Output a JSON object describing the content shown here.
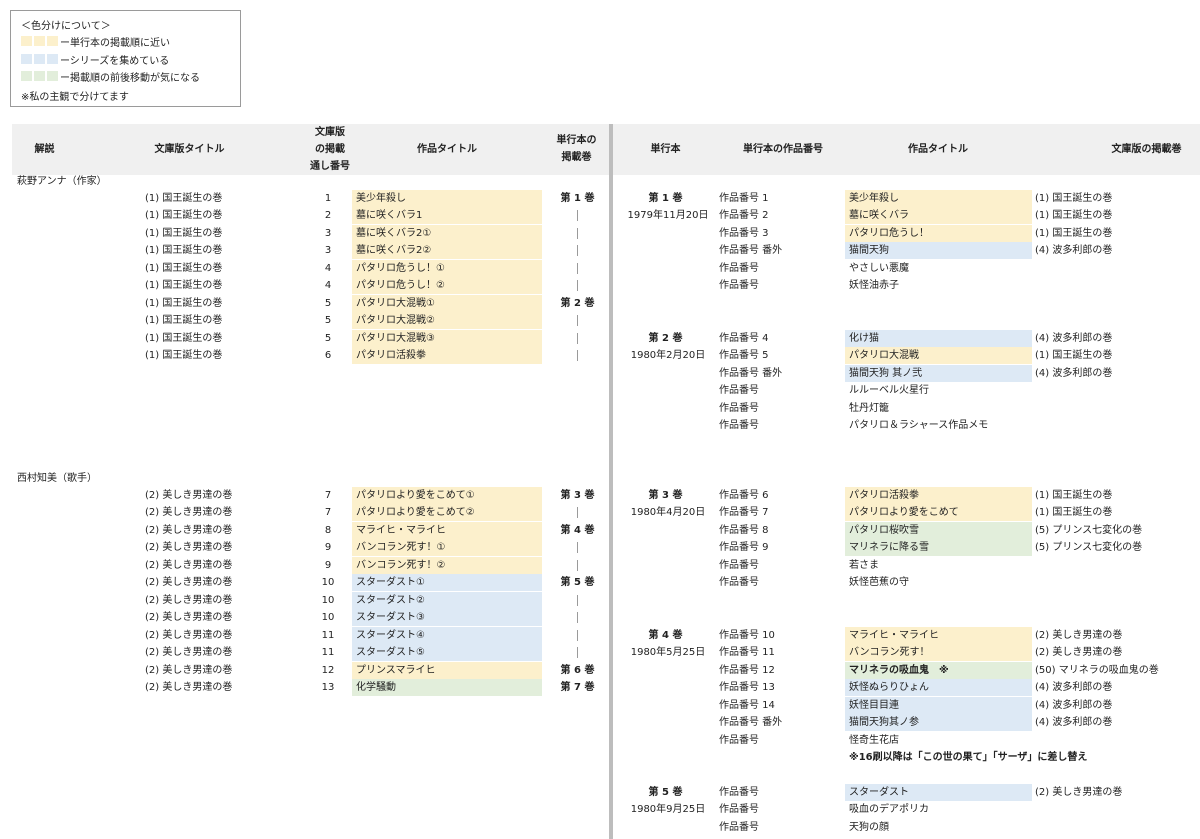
{
  "colors": {
    "yellow": "#fcf0cc",
    "blue": "#dde9f5",
    "green": "#e2eedb",
    "header": "#f0f0f0"
  },
  "legend": {
    "title": "＜色分けについて＞",
    "items": [
      {
        "color": "yellow",
        "label": "ー単行本の掲載順に近い"
      },
      {
        "color": "blue",
        "label": "ーシリーズを集めている"
      },
      {
        "color": "green",
        "label": "ー掲載順の前後移動が気になる"
      }
    ],
    "note": "※私の主観で分けてます"
  },
  "left_headers": {
    "commentary": "解説",
    "bunko_title": "文庫版タイトル",
    "number_l1": "文庫版",
    "number_l2": "の掲載",
    "number_l3": "通し番号",
    "work_title": "作品タイトル",
    "vol_l1": "単行本の",
    "vol_l2": "掲載巻"
  },
  "right_headers": {
    "volume": "単行本",
    "work_number": "単行本の作品番号",
    "work_title": "作品タイトル",
    "bunko_volume": "文庫版の掲載巻"
  },
  "left_sections": [
    {
      "commentary": "萩野アンナ（作家）",
      "rows": [
        {
          "bunko": "(1) 国王誕生の巻",
          "num": "1",
          "title": "美少年殺し",
          "color": "yellow",
          "vol": "第 1 巻"
        },
        {
          "bunko": "(1) 国王誕生の巻",
          "num": "2",
          "title": "墓に咲くバラ1",
          "color": "yellow",
          "vol": "|"
        },
        {
          "bunko": "(1) 国王誕生の巻",
          "num": "3",
          "title": "墓に咲くバラ2①",
          "color": "yellow",
          "vol": "|"
        },
        {
          "bunko": "(1) 国王誕生の巻",
          "num": "3",
          "title": "墓に咲くバラ2②",
          "color": "yellow",
          "vol": "|"
        },
        {
          "bunko": "(1) 国王誕生の巻",
          "num": "4",
          "title": "パタリロ危うし！①",
          "color": "yellow",
          "vol": "|"
        },
        {
          "bunko": "(1) 国王誕生の巻",
          "num": "4",
          "title": "パタリロ危うし！②",
          "color": "yellow",
          "vol": "|"
        },
        {
          "bunko": "(1) 国王誕生の巻",
          "num": "5",
          "title": "パタリロ大混戦①",
          "color": "yellow",
          "vol": "第 2 巻"
        },
        {
          "bunko": "(1) 国王誕生の巻",
          "num": "5",
          "title": "パタリロ大混戦②",
          "color": "yellow",
          "vol": "|"
        },
        {
          "bunko": "(1) 国王誕生の巻",
          "num": "5",
          "title": "パタリロ大混戦③",
          "color": "yellow",
          "vol": "|"
        },
        {
          "bunko": "(1) 国王誕生の巻",
          "num": "6",
          "title": "パタリロ活殺拳",
          "color": "yellow",
          "vol": "|"
        }
      ]
    },
    {
      "commentary": "西村知美（歌手）",
      "rows": [
        {
          "bunko": "(2) 美しき男達の巻",
          "num": "7",
          "title": "パタリロより愛をこめて①",
          "color": "yellow",
          "vol": "第 3 巻"
        },
        {
          "bunko": "(2) 美しき男達の巻",
          "num": "7",
          "title": "パタリロより愛をこめて②",
          "color": "yellow",
          "vol": "|"
        },
        {
          "bunko": "(2) 美しき男達の巻",
          "num": "8",
          "title": "マライヒ・マライヒ",
          "color": "yellow",
          "vol": "第 4 巻"
        },
        {
          "bunko": "(2) 美しき男達の巻",
          "num": "9",
          "title": "バンコラン死す！①",
          "color": "yellow",
          "vol": "|"
        },
        {
          "bunko": "(2) 美しき男達の巻",
          "num": "9",
          "title": "バンコラン死す！②",
          "color": "yellow",
          "vol": "|"
        },
        {
          "bunko": "(2) 美しき男達の巻",
          "num": "10",
          "title": "スターダスト①",
          "color": "blue",
          "vol": "第 5 巻"
        },
        {
          "bunko": "(2) 美しき男達の巻",
          "num": "10",
          "title": "スターダスト②",
          "color": "blue",
          "vol": "|"
        },
        {
          "bunko": "(2) 美しき男達の巻",
          "num": "10",
          "title": "スターダスト③",
          "color": "blue",
          "vol": "|"
        },
        {
          "bunko": "(2) 美しき男達の巻",
          "num": "11",
          "title": "スターダスト④",
          "color": "blue",
          "vol": "|"
        },
        {
          "bunko": "(2) 美しき男達の巻",
          "num": "11",
          "title": "スターダスト⑤",
          "color": "blue",
          "vol": "|"
        },
        {
          "bunko": "(2) 美しき男達の巻",
          "num": "12",
          "title": "プリンスマライヒ",
          "color": "yellow",
          "vol": "第 6 巻"
        },
        {
          "bunko": "(2) 美しき男達の巻",
          "num": "13",
          "title": "化学騒動",
          "color": "green",
          "vol": "第 7 巻"
        }
      ]
    }
  ],
  "right_groups": [
    {
      "volume": "第 1 巻",
      "date": "1979年11月20日",
      "rows": [
        {
          "work_no": "作品番号 1",
          "title": "美少年殺し",
          "color": "yellow",
          "bunko": "(1) 国王誕生の巻"
        },
        {
          "work_no": "作品番号 2",
          "title": "墓に咲くバラ",
          "color": "yellow",
          "bunko": "(1) 国王誕生の巻"
        },
        {
          "work_no": "作品番号 3",
          "title": "パタリロ危うし！",
          "color": "yellow",
          "bunko": "(1) 国王誕生の巻"
        },
        {
          "work_no": "作品番号 番外",
          "title": "猫間天狗",
          "color": "blue",
          "bunko": "(4) 波多利郎の巻"
        },
        {
          "work_no": "作品番号",
          "title": "やさしい悪魔",
          "color": "",
          "bunko": ""
        },
        {
          "work_no": "作品番号",
          "title": "妖怪油赤子",
          "color": "",
          "bunko": ""
        }
      ]
    },
    {
      "volume": "第 2 巻",
      "date": "1980年2月20日",
      "rows": [
        {
          "work_no": "作品番号 4",
          "title": "化け猫",
          "color": "blue",
          "bunko": "(4) 波多利郎の巻"
        },
        {
          "work_no": "作品番号 5",
          "title": "パタリロ大混戦",
          "color": "yellow",
          "bunko": "(1) 国王誕生の巻"
        },
        {
          "work_no": "作品番号 番外",
          "title": "猫間天狗 其ノ弐",
          "color": "blue",
          "bunko": "(4) 波多利郎の巻"
        },
        {
          "work_no": "作品番号",
          "title": "ルルーベル火星行",
          "color": "",
          "bunko": ""
        },
        {
          "work_no": "作品番号",
          "title": "牡丹灯籠",
          "color": "",
          "bunko": ""
        },
        {
          "work_no": "作品番号",
          "title": "パタリロ＆ラシャース作品メモ",
          "color": "",
          "bunko": ""
        }
      ]
    },
    {
      "volume": "第 3 巻",
      "date": "1980年4月20日",
      "rows": [
        {
          "work_no": "作品番号 6",
          "title": "パタリロ活殺拳",
          "color": "yellow",
          "bunko": "(1) 国王誕生の巻"
        },
        {
          "work_no": "作品番号 7",
          "title": "パタリロより愛をこめて",
          "color": "yellow",
          "bunko": "(1) 国王誕生の巻"
        },
        {
          "work_no": "作品番号 8",
          "title": "パタリロ桜吹雪",
          "color": "green",
          "bunko": "(5) プリンス七変化の巻"
        },
        {
          "work_no": "作品番号 9",
          "title": "マリネラに降る雪",
          "color": "green",
          "bunko": "(5) プリンス七変化の巻"
        },
        {
          "work_no": "作品番号",
          "title": "若さま",
          "color": "",
          "bunko": ""
        },
        {
          "work_no": "作品番号",
          "title": "妖怪芭蕉の守",
          "color": "",
          "bunko": ""
        }
      ]
    },
    {
      "volume": "第 4 巻",
      "date": "1980年5月25日",
      "rows": [
        {
          "work_no": "作品番号 10",
          "title": "マライヒ・マライヒ",
          "color": "yellow",
          "bunko": "(2) 美しき男達の巻"
        },
        {
          "work_no": "作品番号 11",
          "title": "バンコラン死す！",
          "color": "yellow",
          "bunko": "(2) 美しき男達の巻"
        },
        {
          "work_no": "作品番号 12",
          "title": "マリネラの吸血鬼　※",
          "color": "green",
          "bunko": "(50) マリネラの吸血鬼の巻",
          "bold": true
        },
        {
          "work_no": "作品番号 13",
          "title": "妖怪ぬらりひょん",
          "color": "blue",
          "bunko": "(4) 波多利郎の巻"
        },
        {
          "work_no": "作品番号 14",
          "title": "妖怪目目連",
          "color": "blue",
          "bunko": "(4) 波多利郎の巻"
        },
        {
          "work_no": "作品番号 番外",
          "title": "猫間天狗其ノ参",
          "color": "blue",
          "bunko": "(4) 波多利郎の巻"
        },
        {
          "work_no": "作品番号",
          "title": "怪奇生花店",
          "color": "",
          "bunko": ""
        }
      ],
      "footnote": "※16刷以降は「この世の果て」「サーザ」に差し替え"
    },
    {
      "volume": "第 5 巻",
      "date": "1980年9月25日",
      "rows": [
        {
          "work_no": "作品番号",
          "title": "スターダスト",
          "color": "blue",
          "bunko": "(2) 美しき男達の巻"
        },
        {
          "work_no": "作品番号",
          "title": "吸血のデアポリカ",
          "color": "",
          "bunko": ""
        },
        {
          "work_no": "作品番号",
          "title": "天狗の顔",
          "color": "",
          "bunko": ""
        }
      ]
    }
  ]
}
